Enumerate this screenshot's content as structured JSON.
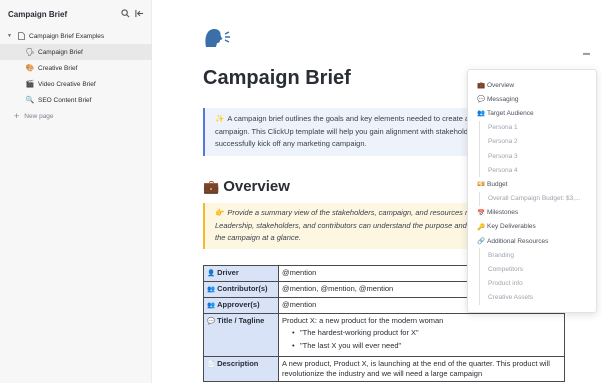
{
  "sidebar": {
    "title": "Campaign Brief",
    "search_icon": "search-icon",
    "collapse_icon": "collapse-sidebar-icon",
    "root": {
      "label": "Campaign Brief Examples",
      "icon": "document-icon"
    },
    "items": [
      {
        "label": "Campaign Brief",
        "icon": "megaphone-icon",
        "active": true
      },
      {
        "label": "Creative Brief",
        "icon": "palette-icon",
        "active": false
      },
      {
        "label": "Video Creative Brief",
        "icon": "clapper-board-icon",
        "active": false
      },
      {
        "label": "SEO Content Brief",
        "icon": "magnifier-icon",
        "active": false
      }
    ],
    "new_page": "New page"
  },
  "doc": {
    "page_icon": "speaking-head-icon",
    "title": "Campaign Brief",
    "intro_callout": "A campaign brief outlines the goals and key elements needed to create a successful campaign. This ClickUp template will help you gain alignment with stakeholders and successfully kick off any marketing campaign.",
    "overview_heading": "Overview",
    "overview_callout": "Provide a summary view of the stakeholders, campaign, and resources needed. Leadership, stakeholders, and contributors can understand the purpose and information of the campaign at a glance.",
    "table": {
      "driver_label": "Driver",
      "driver_value": "@mention",
      "contributors_label": "Contributor(s)",
      "contributors_value": "@mention, @mention, @mention",
      "approvers_label": "Approver(s)",
      "approvers_value": "@mention",
      "title_label": "Title / Tagline",
      "title_value": "Product X: a new product for the modern woman",
      "title_bullets": [
        "\"The hardest-working product for X\"",
        "\"The last X you will ever need\""
      ],
      "description_label": "Description",
      "description_value": "A new product, Product X, is launching at the end of the quarter. This product will revolutionize the industry and we will need a large campaign"
    }
  },
  "toc": {
    "items": [
      {
        "label": "Overview",
        "level": 1,
        "icon": "briefcase-icon"
      },
      {
        "label": "Messaging",
        "level": 1,
        "icon": "speech-bubble-icon"
      },
      {
        "label": "Target Audience",
        "level": 1,
        "icon": "people-icon"
      },
      {
        "label": "Persona 1",
        "level": 2
      },
      {
        "label": "Persona 2",
        "level": 2
      },
      {
        "label": "Persona 3",
        "level": 2
      },
      {
        "label": "Persona 4",
        "level": 2
      },
      {
        "label": "Budget",
        "level": 1,
        "icon": "money-icon"
      },
      {
        "label": "Overall Campaign Budget: $3,...",
        "level": 2
      },
      {
        "label": "Milestones",
        "level": 1,
        "icon": "calendar-icon"
      },
      {
        "label": "Key Deliverables",
        "level": 1,
        "icon": "key-icon"
      },
      {
        "label": "Additional Resources",
        "level": 1,
        "icon": "link-icon"
      },
      {
        "label": "Branding",
        "level": 2
      },
      {
        "label": "Competitors",
        "level": 2
      },
      {
        "label": "Product info",
        "level": 2
      },
      {
        "label": "Creative Assets",
        "level": 2
      }
    ]
  }
}
